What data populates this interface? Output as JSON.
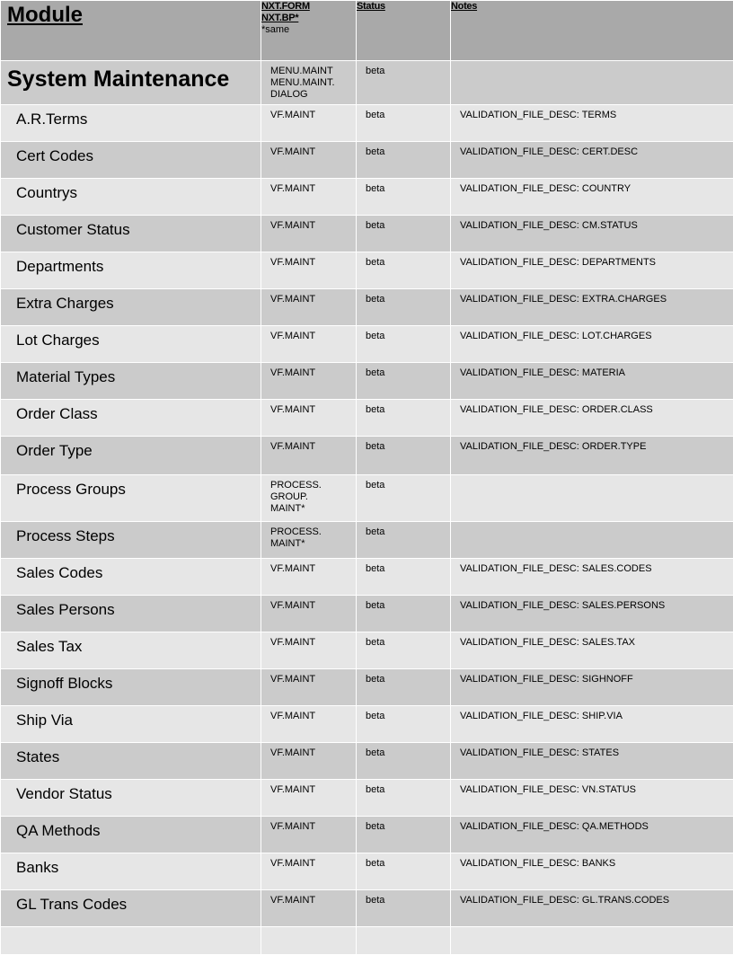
{
  "header": {
    "module": "Module",
    "form_line1": "NXT.FORM",
    "form_line2": "NXT.BP*",
    "form_note": "*same",
    "status": "Status",
    "notes": "Notes"
  },
  "section": {
    "title": "System Maintenance",
    "form": "MENU.MAINT\nMENU.MAINT.\nDIALOG",
    "status": "beta",
    "notes": ""
  },
  "rows": [
    {
      "name": "A.R.Terms",
      "form": "VF.MAINT",
      "status": "beta",
      "notes": "VALIDATION_FILE_DESC: TERMS"
    },
    {
      "name": "Cert Codes",
      "form": "VF.MAINT",
      "status": "beta",
      "notes": "VALIDATION_FILE_DESC: CERT.DESC"
    },
    {
      "name": "Countrys",
      "form": "VF.MAINT",
      "status": "beta",
      "notes": "VALIDATION_FILE_DESC: COUNTRY"
    },
    {
      "name": "Customer Status",
      "form": "VF.MAINT",
      "status": "beta",
      "notes": "VALIDATION_FILE_DESC:  CM.STATUS"
    },
    {
      "name": "Departments",
      "form": "VF.MAINT",
      "status": "beta",
      "notes": "VALIDATION_FILE_DESC: DEPARTMENTS"
    },
    {
      "name": "Extra Charges",
      "form": "VF.MAINT",
      "status": "beta",
      "notes": "VALIDATION_FILE_DESC: EXTRA.CHARGES"
    },
    {
      "name": "Lot Charges",
      "form": "VF.MAINT",
      "status": "beta",
      "notes": "VALIDATION_FILE_DESC: LOT.CHARGES"
    },
    {
      "name": "Material Types",
      "form": "VF.MAINT",
      "status": "beta",
      "notes": "VALIDATION_FILE_DESC: MATERIA"
    },
    {
      "name": "Order Class",
      "form": "VF.MAINT",
      "status": "beta",
      "notes": "VALIDATION_FILE_DESC: ORDER.CLASS"
    },
    {
      "name": "Order Type",
      "form": "VF.MAINT",
      "status": "beta",
      "notes": "VALIDATION_FILE_DESC: ORDER.TYPE"
    },
    {
      "name": "Process Groups",
      "form": "PROCESS.\nGROUP.\nMAINT*",
      "status": "beta",
      "notes": ""
    },
    {
      "name": "Process Steps",
      "form": "PROCESS.\nMAINT*",
      "status": "beta",
      "notes": ""
    },
    {
      "name": "Sales Codes",
      "form": "VF.MAINT",
      "status": "beta",
      "notes": "VALIDATION_FILE_DESC: SALES.CODES"
    },
    {
      "name": "Sales Persons",
      "form": "VF.MAINT",
      "status": "beta",
      "notes": "VALIDATION_FILE_DESC: SALES.PERSONS"
    },
    {
      "name": "Sales Tax",
      "form": "VF.MAINT",
      "status": "beta",
      "notes": "VALIDATION_FILE_DESC: SALES.TAX"
    },
    {
      "name": "Signoff Blocks",
      "form": "VF.MAINT",
      "status": "beta",
      "notes": "VALIDATION_FILE_DESC: SIGHNOFF"
    },
    {
      "name": "Ship Via",
      "form": "VF.MAINT",
      "status": "beta",
      "notes": "VALIDATION_FILE_DESC: SHIP.VIA"
    },
    {
      "name": "States",
      "form": "VF.MAINT",
      "status": "beta",
      "notes": "VALIDATION_FILE_DESC: STATES"
    },
    {
      "name": "Vendor Status",
      "form": "VF.MAINT",
      "status": "beta",
      "notes": "VALIDATION_FILE_DESC: VN.STATUS"
    },
    {
      "name": "QA Methods",
      "form": "VF.MAINT",
      "status": "beta",
      "notes": "VALIDATION_FILE_DESC: QA.METHODS"
    },
    {
      "name": "Banks",
      "form": "VF.MAINT",
      "status": "beta",
      "notes": "VALIDATION_FILE_DESC: BANKS"
    },
    {
      "name": "GL Trans Codes",
      "form": "VF.MAINT",
      "status": "beta",
      "notes": "VALIDATION_FILE_DESC: GL.TRANS.CODES"
    }
  ],
  "colors": {
    "header_bg": "#a9a9a9",
    "row_light": "#e6e6e6",
    "row_dark": "#cbcbcb"
  }
}
